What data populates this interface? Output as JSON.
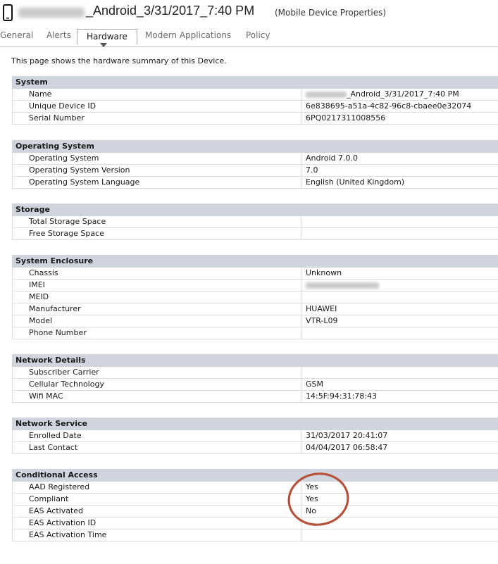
{
  "window": {
    "title": "_Android_3/31/2017_7:40 PM",
    "subtitle": "(Mobile Device Properties)"
  },
  "tabs": [
    {
      "label": "General"
    },
    {
      "label": "Alerts"
    },
    {
      "label": "Hardware"
    },
    {
      "label": "Modern Applications"
    },
    {
      "label": "Policy"
    }
  ],
  "intro": "This page shows the hardware summary of this Device.",
  "sections": [
    {
      "title": "System",
      "rows": [
        {
          "key": "Name",
          "value": "_Android_3/31/2017_7:40 PM"
        },
        {
          "key": "Unique Device ID",
          "value": "6e838695-a51a-4c82-96c8-cbaee0e32074"
        },
        {
          "key": "Serial Number",
          "value": "6PQ0217311008556"
        }
      ]
    },
    {
      "title": "Operating System",
      "rows": [
        {
          "key": "Operating System",
          "value": "Android 7.0.0"
        },
        {
          "key": "Operating System Version",
          "value": "7.0"
        },
        {
          "key": "Operating System Language",
          "value": "English (United Kingdom)"
        }
      ]
    },
    {
      "title": "Storage",
      "rows": [
        {
          "key": "Total Storage Space",
          "value": ""
        },
        {
          "key": "Free Storage Space",
          "value": ""
        }
      ]
    },
    {
      "title": "System Enclosure",
      "rows": [
        {
          "key": "Chassis",
          "value": "Unknown"
        },
        {
          "key": "IMEI",
          "value": ""
        },
        {
          "key": "MEID",
          "value": ""
        },
        {
          "key": "Manufacturer",
          "value": "HUAWEI"
        },
        {
          "key": "Model",
          "value": "VTR-L09"
        },
        {
          "key": "Phone Number",
          "value": ""
        }
      ]
    },
    {
      "title": "Network Details",
      "rows": [
        {
          "key": "Subscriber Carrier",
          "value": ""
        },
        {
          "key": "Cellular Technology",
          "value": "GSM"
        },
        {
          "key": "Wifi MAC",
          "value": "14:5F:94:31:78:43"
        }
      ]
    },
    {
      "title": "Network Service",
      "rows": [
        {
          "key": "Enrolled Date",
          "value": "31/03/2017 20:41:07"
        },
        {
          "key": "Last Contact",
          "value": "04/04/2017 06:58:47"
        }
      ]
    },
    {
      "title": "Conditional Access",
      "rows": [
        {
          "key": "AAD Registered",
          "value": "Yes"
        },
        {
          "key": "Compliant",
          "value": "Yes"
        },
        {
          "key": "EAS Activated",
          "value": "No"
        },
        {
          "key": "EAS Activation ID",
          "value": ""
        },
        {
          "key": "EAS Activation Time",
          "value": ""
        }
      ]
    }
  ],
  "colors": {
    "section_header_bg": "#cfd4de",
    "annotation_circle": "#b5523b"
  },
  "icons": [
    "mobile-phone-icon"
  ]
}
